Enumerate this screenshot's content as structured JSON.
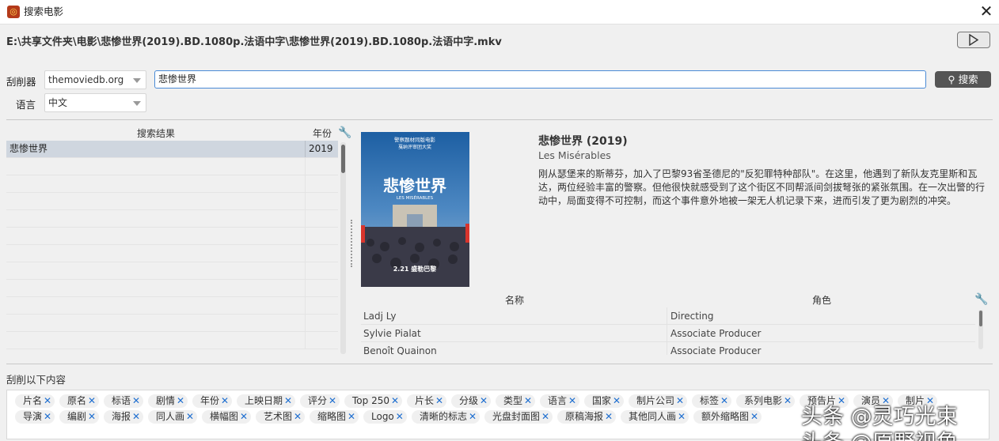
{
  "window": {
    "title": "搜索电影",
    "app_icon": "app-logo-icon",
    "close_glyph": "✕"
  },
  "file_path": "E:\\共享文件夹\\电影\\悲惨世界(2019).BD.1080p.法语中字\\悲惨世界(2019).BD.1080p.法语中字.mkv",
  "scraper": {
    "label": "刮削器",
    "value": "themoviedb.org"
  },
  "language": {
    "label": "语言",
    "value": "中文"
  },
  "search": {
    "value": "悲惨世界",
    "button_label": "搜索"
  },
  "results": {
    "headers": {
      "title": "搜索结果",
      "year": "年份"
    },
    "rows": [
      {
        "title": "悲惨世界",
        "year": "2019"
      }
    ]
  },
  "movie": {
    "title": "悲惨世界 (2019)",
    "original_title": "Les Misérables",
    "description": "刚从瑟堡来的斯蒂芬，加入了巴黎93省圣德尼的\"反犯罪特种部队\"。在这里，他遇到了新队友克里斯和瓦达，两位经验丰富的警察。但他很快就感受到了这个街区不同帮派间剑拔弩张的紧张氛围。在一次出警的行动中，局面变得不可控制，而这个事件意外地被一架无人机记录下来，进而引发了更为剧烈的冲突。",
    "poster": {
      "line1": "警察题材同版电影",
      "line2": "戛纳评审团大奖",
      "title": "悲惨世界",
      "subtitle": "LES MISÉRABLES",
      "date": "2.21 盛勒巴黎"
    }
  },
  "crew": {
    "headers": {
      "name": "名称",
      "role": "角色"
    },
    "rows": [
      {
        "name": "Ladj Ly",
        "role": "Directing"
      },
      {
        "name": "Sylvie Pialat",
        "role": "Associate Producer"
      },
      {
        "name": "Benoît Quainon",
        "role": "Associate Producer"
      }
    ]
  },
  "scrape_section": {
    "label": "刮削以下内容"
  },
  "tags_row1": [
    "片名",
    "原名",
    "标语",
    "剧情",
    "年份",
    "上映日期",
    "评分",
    "Top 250",
    "片长",
    "分级",
    "类型",
    "语言",
    "国家",
    "制片公司",
    "标签",
    "系列电影",
    "预告片",
    "演员",
    "制片"
  ],
  "tags_row2": [
    "导演",
    "编剧",
    "海报",
    "同人画",
    "横幅图",
    "艺术图",
    "缩略图",
    "Logo",
    "清晰的标志",
    "光盘封面图",
    "原稿海报",
    "其他同人画",
    "额外缩略图"
  ],
  "watermark": {
    "line1": "头条 @灵巧光束",
    "line2": "头条 @原野视角"
  }
}
